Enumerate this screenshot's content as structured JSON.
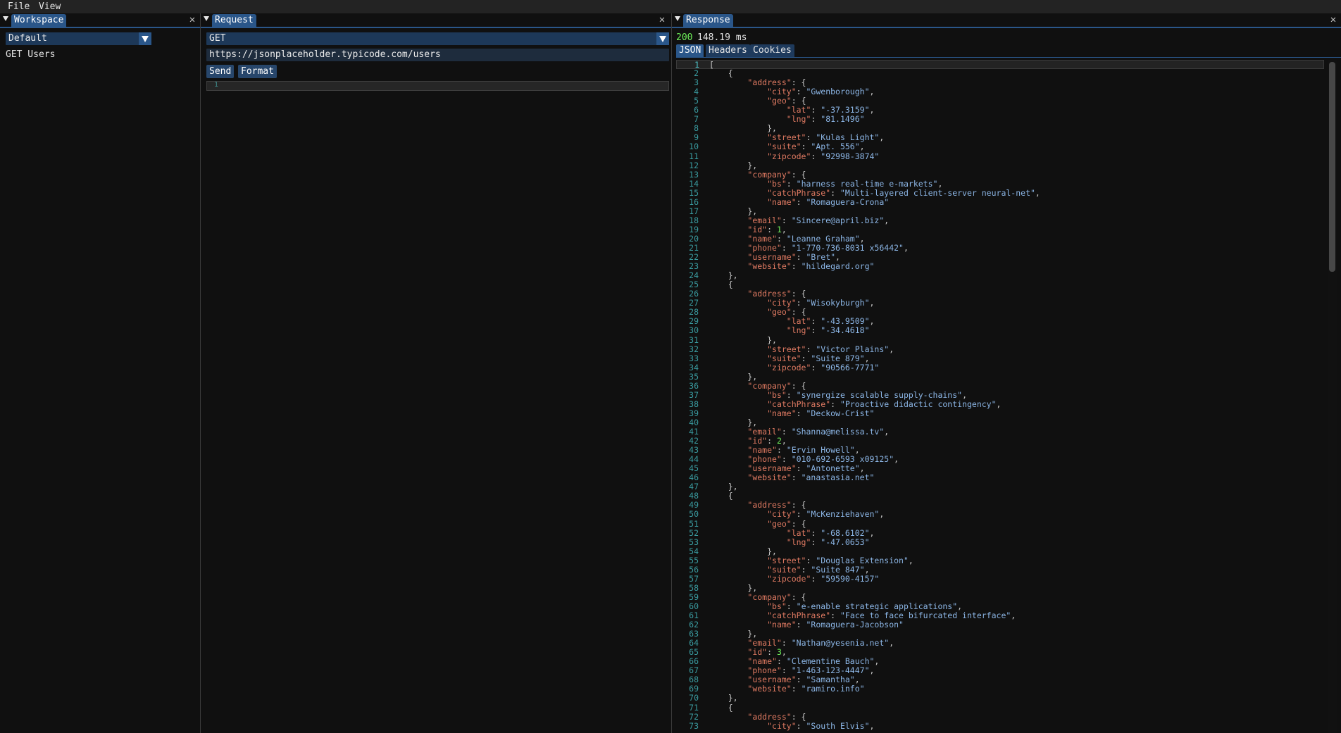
{
  "menu": {
    "file": "File",
    "view": "View"
  },
  "workspace": {
    "title": "Workspace",
    "selected": "Default",
    "items": [
      "GET Users"
    ]
  },
  "request": {
    "title": "Request",
    "method": "GET",
    "url": "https://jsonplaceholder.typicode.com/users",
    "send_label": "Send",
    "format_label": "Format",
    "body_line_number": "1"
  },
  "response": {
    "title": "Response",
    "status_code": "200",
    "time": "148.19 ms",
    "tabs": [
      "JSON",
      "Headers",
      "Cookies"
    ],
    "active_tab": "JSON"
  },
  "colors": {
    "accent": "#2a5689",
    "json_key": "#e07a62",
    "json_string": "#8cb6e6",
    "json_number": "#6ef05a",
    "line_number": "#3a9ba0",
    "status_ok": "#6ef05a"
  },
  "icons": {
    "panel_collapse": "triangle-down-icon",
    "close": "close-icon",
    "combo_arrow": "chevron-down-icon"
  },
  "json_lines": [
    [
      {
        "t": "p",
        "v": "["
      }
    ],
    [
      {
        "t": "p",
        "v": "    {"
      }
    ],
    [
      {
        "t": "p",
        "v": "        "
      },
      {
        "t": "k",
        "v": "\"address\""
      },
      {
        "t": "p",
        "v": ": {"
      }
    ],
    [
      {
        "t": "p",
        "v": "            "
      },
      {
        "t": "k",
        "v": "\"city\""
      },
      {
        "t": "p",
        "v": ": "
      },
      {
        "t": "s",
        "v": "\"Gwenborough\""
      },
      {
        "t": "p",
        "v": ","
      }
    ],
    [
      {
        "t": "p",
        "v": "            "
      },
      {
        "t": "k",
        "v": "\"geo\""
      },
      {
        "t": "p",
        "v": ": {"
      }
    ],
    [
      {
        "t": "p",
        "v": "                "
      },
      {
        "t": "k",
        "v": "\"lat\""
      },
      {
        "t": "p",
        "v": ": "
      },
      {
        "t": "s",
        "v": "\"-37.3159\""
      },
      {
        "t": "p",
        "v": ","
      }
    ],
    [
      {
        "t": "p",
        "v": "                "
      },
      {
        "t": "k",
        "v": "\"lng\""
      },
      {
        "t": "p",
        "v": ": "
      },
      {
        "t": "s",
        "v": "\"81.1496\""
      }
    ],
    [
      {
        "t": "p",
        "v": "            },"
      }
    ],
    [
      {
        "t": "p",
        "v": "            "
      },
      {
        "t": "k",
        "v": "\"street\""
      },
      {
        "t": "p",
        "v": ": "
      },
      {
        "t": "s",
        "v": "\"Kulas Light\""
      },
      {
        "t": "p",
        "v": ","
      }
    ],
    [
      {
        "t": "p",
        "v": "            "
      },
      {
        "t": "k",
        "v": "\"suite\""
      },
      {
        "t": "p",
        "v": ": "
      },
      {
        "t": "s",
        "v": "\"Apt. 556\""
      },
      {
        "t": "p",
        "v": ","
      }
    ],
    [
      {
        "t": "p",
        "v": "            "
      },
      {
        "t": "k",
        "v": "\"zipcode\""
      },
      {
        "t": "p",
        "v": ": "
      },
      {
        "t": "s",
        "v": "\"92998-3874\""
      }
    ],
    [
      {
        "t": "p",
        "v": "        },"
      }
    ],
    [
      {
        "t": "p",
        "v": "        "
      },
      {
        "t": "k",
        "v": "\"company\""
      },
      {
        "t": "p",
        "v": ": {"
      }
    ],
    [
      {
        "t": "p",
        "v": "            "
      },
      {
        "t": "k",
        "v": "\"bs\""
      },
      {
        "t": "p",
        "v": ": "
      },
      {
        "t": "s",
        "v": "\"harness real-time e-markets\""
      },
      {
        "t": "p",
        "v": ","
      }
    ],
    [
      {
        "t": "p",
        "v": "            "
      },
      {
        "t": "k",
        "v": "\"catchPhrase\""
      },
      {
        "t": "p",
        "v": ": "
      },
      {
        "t": "s",
        "v": "\"Multi-layered client-server neural-net\""
      },
      {
        "t": "p",
        "v": ","
      }
    ],
    [
      {
        "t": "p",
        "v": "            "
      },
      {
        "t": "k",
        "v": "\"name\""
      },
      {
        "t": "p",
        "v": ": "
      },
      {
        "t": "s",
        "v": "\"Romaguera-Crona\""
      }
    ],
    [
      {
        "t": "p",
        "v": "        },"
      }
    ],
    [
      {
        "t": "p",
        "v": "        "
      },
      {
        "t": "k",
        "v": "\"email\""
      },
      {
        "t": "p",
        "v": ": "
      },
      {
        "t": "s",
        "v": "\"Sincere@april.biz\""
      },
      {
        "t": "p",
        "v": ","
      }
    ],
    [
      {
        "t": "p",
        "v": "        "
      },
      {
        "t": "k",
        "v": "\"id\""
      },
      {
        "t": "p",
        "v": ": "
      },
      {
        "t": "n",
        "v": "1"
      },
      {
        "t": "p",
        "v": ","
      }
    ],
    [
      {
        "t": "p",
        "v": "        "
      },
      {
        "t": "k",
        "v": "\"name\""
      },
      {
        "t": "p",
        "v": ": "
      },
      {
        "t": "s",
        "v": "\"Leanne Graham\""
      },
      {
        "t": "p",
        "v": ","
      }
    ],
    [
      {
        "t": "p",
        "v": "        "
      },
      {
        "t": "k",
        "v": "\"phone\""
      },
      {
        "t": "p",
        "v": ": "
      },
      {
        "t": "s",
        "v": "\"1-770-736-8031 x56442\""
      },
      {
        "t": "p",
        "v": ","
      }
    ],
    [
      {
        "t": "p",
        "v": "        "
      },
      {
        "t": "k",
        "v": "\"username\""
      },
      {
        "t": "p",
        "v": ": "
      },
      {
        "t": "s",
        "v": "\"Bret\""
      },
      {
        "t": "p",
        "v": ","
      }
    ],
    [
      {
        "t": "p",
        "v": "        "
      },
      {
        "t": "k",
        "v": "\"website\""
      },
      {
        "t": "p",
        "v": ": "
      },
      {
        "t": "s",
        "v": "\"hildegard.org\""
      }
    ],
    [
      {
        "t": "p",
        "v": "    },"
      }
    ],
    [
      {
        "t": "p",
        "v": "    {"
      }
    ],
    [
      {
        "t": "p",
        "v": "        "
      },
      {
        "t": "k",
        "v": "\"address\""
      },
      {
        "t": "p",
        "v": ": {"
      }
    ],
    [
      {
        "t": "p",
        "v": "            "
      },
      {
        "t": "k",
        "v": "\"city\""
      },
      {
        "t": "p",
        "v": ": "
      },
      {
        "t": "s",
        "v": "\"Wisokyburgh\""
      },
      {
        "t": "p",
        "v": ","
      }
    ],
    [
      {
        "t": "p",
        "v": "            "
      },
      {
        "t": "k",
        "v": "\"geo\""
      },
      {
        "t": "p",
        "v": ": {"
      }
    ],
    [
      {
        "t": "p",
        "v": "                "
      },
      {
        "t": "k",
        "v": "\"lat\""
      },
      {
        "t": "p",
        "v": ": "
      },
      {
        "t": "s",
        "v": "\"-43.9509\""
      },
      {
        "t": "p",
        "v": ","
      }
    ],
    [
      {
        "t": "p",
        "v": "                "
      },
      {
        "t": "k",
        "v": "\"lng\""
      },
      {
        "t": "p",
        "v": ": "
      },
      {
        "t": "s",
        "v": "\"-34.4618\""
      }
    ],
    [
      {
        "t": "p",
        "v": "            },"
      }
    ],
    [
      {
        "t": "p",
        "v": "            "
      },
      {
        "t": "k",
        "v": "\"street\""
      },
      {
        "t": "p",
        "v": ": "
      },
      {
        "t": "s",
        "v": "\"Victor Plains\""
      },
      {
        "t": "p",
        "v": ","
      }
    ],
    [
      {
        "t": "p",
        "v": "            "
      },
      {
        "t": "k",
        "v": "\"suite\""
      },
      {
        "t": "p",
        "v": ": "
      },
      {
        "t": "s",
        "v": "\"Suite 879\""
      },
      {
        "t": "p",
        "v": ","
      }
    ],
    [
      {
        "t": "p",
        "v": "            "
      },
      {
        "t": "k",
        "v": "\"zipcode\""
      },
      {
        "t": "p",
        "v": ": "
      },
      {
        "t": "s",
        "v": "\"90566-7771\""
      }
    ],
    [
      {
        "t": "p",
        "v": "        },"
      }
    ],
    [
      {
        "t": "p",
        "v": "        "
      },
      {
        "t": "k",
        "v": "\"company\""
      },
      {
        "t": "p",
        "v": ": {"
      }
    ],
    [
      {
        "t": "p",
        "v": "            "
      },
      {
        "t": "k",
        "v": "\"bs\""
      },
      {
        "t": "p",
        "v": ": "
      },
      {
        "t": "s",
        "v": "\"synergize scalable supply-chains\""
      },
      {
        "t": "p",
        "v": ","
      }
    ],
    [
      {
        "t": "p",
        "v": "            "
      },
      {
        "t": "k",
        "v": "\"catchPhrase\""
      },
      {
        "t": "p",
        "v": ": "
      },
      {
        "t": "s",
        "v": "\"Proactive didactic contingency\""
      },
      {
        "t": "p",
        "v": ","
      }
    ],
    [
      {
        "t": "p",
        "v": "            "
      },
      {
        "t": "k",
        "v": "\"name\""
      },
      {
        "t": "p",
        "v": ": "
      },
      {
        "t": "s",
        "v": "\"Deckow-Crist\""
      }
    ],
    [
      {
        "t": "p",
        "v": "        },"
      }
    ],
    [
      {
        "t": "p",
        "v": "        "
      },
      {
        "t": "k",
        "v": "\"email\""
      },
      {
        "t": "p",
        "v": ": "
      },
      {
        "t": "s",
        "v": "\"Shanna@melissa.tv\""
      },
      {
        "t": "p",
        "v": ","
      }
    ],
    [
      {
        "t": "p",
        "v": "        "
      },
      {
        "t": "k",
        "v": "\"id\""
      },
      {
        "t": "p",
        "v": ": "
      },
      {
        "t": "n",
        "v": "2"
      },
      {
        "t": "p",
        "v": ","
      }
    ],
    [
      {
        "t": "p",
        "v": "        "
      },
      {
        "t": "k",
        "v": "\"name\""
      },
      {
        "t": "p",
        "v": ": "
      },
      {
        "t": "s",
        "v": "\"Ervin Howell\""
      },
      {
        "t": "p",
        "v": ","
      }
    ],
    [
      {
        "t": "p",
        "v": "        "
      },
      {
        "t": "k",
        "v": "\"phone\""
      },
      {
        "t": "p",
        "v": ": "
      },
      {
        "t": "s",
        "v": "\"010-692-6593 x09125\""
      },
      {
        "t": "p",
        "v": ","
      }
    ],
    [
      {
        "t": "p",
        "v": "        "
      },
      {
        "t": "k",
        "v": "\"username\""
      },
      {
        "t": "p",
        "v": ": "
      },
      {
        "t": "s",
        "v": "\"Antonette\""
      },
      {
        "t": "p",
        "v": ","
      }
    ],
    [
      {
        "t": "p",
        "v": "        "
      },
      {
        "t": "k",
        "v": "\"website\""
      },
      {
        "t": "p",
        "v": ": "
      },
      {
        "t": "s",
        "v": "\"anastasia.net\""
      }
    ],
    [
      {
        "t": "p",
        "v": "    },"
      }
    ],
    [
      {
        "t": "p",
        "v": "    {"
      }
    ],
    [
      {
        "t": "p",
        "v": "        "
      },
      {
        "t": "k",
        "v": "\"address\""
      },
      {
        "t": "p",
        "v": ": {"
      }
    ],
    [
      {
        "t": "p",
        "v": "            "
      },
      {
        "t": "k",
        "v": "\"city\""
      },
      {
        "t": "p",
        "v": ": "
      },
      {
        "t": "s",
        "v": "\"McKenziehaven\""
      },
      {
        "t": "p",
        "v": ","
      }
    ],
    [
      {
        "t": "p",
        "v": "            "
      },
      {
        "t": "k",
        "v": "\"geo\""
      },
      {
        "t": "p",
        "v": ": {"
      }
    ],
    [
      {
        "t": "p",
        "v": "                "
      },
      {
        "t": "k",
        "v": "\"lat\""
      },
      {
        "t": "p",
        "v": ": "
      },
      {
        "t": "s",
        "v": "\"-68.6102\""
      },
      {
        "t": "p",
        "v": ","
      }
    ],
    [
      {
        "t": "p",
        "v": "                "
      },
      {
        "t": "k",
        "v": "\"lng\""
      },
      {
        "t": "p",
        "v": ": "
      },
      {
        "t": "s",
        "v": "\"-47.0653\""
      }
    ],
    [
      {
        "t": "p",
        "v": "            },"
      }
    ],
    [
      {
        "t": "p",
        "v": "            "
      },
      {
        "t": "k",
        "v": "\"street\""
      },
      {
        "t": "p",
        "v": ": "
      },
      {
        "t": "s",
        "v": "\"Douglas Extension\""
      },
      {
        "t": "p",
        "v": ","
      }
    ],
    [
      {
        "t": "p",
        "v": "            "
      },
      {
        "t": "k",
        "v": "\"suite\""
      },
      {
        "t": "p",
        "v": ": "
      },
      {
        "t": "s",
        "v": "\"Suite 847\""
      },
      {
        "t": "p",
        "v": ","
      }
    ],
    [
      {
        "t": "p",
        "v": "            "
      },
      {
        "t": "k",
        "v": "\"zipcode\""
      },
      {
        "t": "p",
        "v": ": "
      },
      {
        "t": "s",
        "v": "\"59590-4157\""
      }
    ],
    [
      {
        "t": "p",
        "v": "        },"
      }
    ],
    [
      {
        "t": "p",
        "v": "        "
      },
      {
        "t": "k",
        "v": "\"company\""
      },
      {
        "t": "p",
        "v": ": {"
      }
    ],
    [
      {
        "t": "p",
        "v": "            "
      },
      {
        "t": "k",
        "v": "\"bs\""
      },
      {
        "t": "p",
        "v": ": "
      },
      {
        "t": "s",
        "v": "\"e-enable strategic applications\""
      },
      {
        "t": "p",
        "v": ","
      }
    ],
    [
      {
        "t": "p",
        "v": "            "
      },
      {
        "t": "k",
        "v": "\"catchPhrase\""
      },
      {
        "t": "p",
        "v": ": "
      },
      {
        "t": "s",
        "v": "\"Face to face bifurcated interface\""
      },
      {
        "t": "p",
        "v": ","
      }
    ],
    [
      {
        "t": "p",
        "v": "            "
      },
      {
        "t": "k",
        "v": "\"name\""
      },
      {
        "t": "p",
        "v": ": "
      },
      {
        "t": "s",
        "v": "\"Romaguera-Jacobson\""
      }
    ],
    [
      {
        "t": "p",
        "v": "        },"
      }
    ],
    [
      {
        "t": "p",
        "v": "        "
      },
      {
        "t": "k",
        "v": "\"email\""
      },
      {
        "t": "p",
        "v": ": "
      },
      {
        "t": "s",
        "v": "\"Nathan@yesenia.net\""
      },
      {
        "t": "p",
        "v": ","
      }
    ],
    [
      {
        "t": "p",
        "v": "        "
      },
      {
        "t": "k",
        "v": "\"id\""
      },
      {
        "t": "p",
        "v": ": "
      },
      {
        "t": "n",
        "v": "3"
      },
      {
        "t": "p",
        "v": ","
      }
    ],
    [
      {
        "t": "p",
        "v": "        "
      },
      {
        "t": "k",
        "v": "\"name\""
      },
      {
        "t": "p",
        "v": ": "
      },
      {
        "t": "s",
        "v": "\"Clementine Bauch\""
      },
      {
        "t": "p",
        "v": ","
      }
    ],
    [
      {
        "t": "p",
        "v": "        "
      },
      {
        "t": "k",
        "v": "\"phone\""
      },
      {
        "t": "p",
        "v": ": "
      },
      {
        "t": "s",
        "v": "\"1-463-123-4447\""
      },
      {
        "t": "p",
        "v": ","
      }
    ],
    [
      {
        "t": "p",
        "v": "        "
      },
      {
        "t": "k",
        "v": "\"username\""
      },
      {
        "t": "p",
        "v": ": "
      },
      {
        "t": "s",
        "v": "\"Samantha\""
      },
      {
        "t": "p",
        "v": ","
      }
    ],
    [
      {
        "t": "p",
        "v": "        "
      },
      {
        "t": "k",
        "v": "\"website\""
      },
      {
        "t": "p",
        "v": ": "
      },
      {
        "t": "s",
        "v": "\"ramiro.info\""
      }
    ],
    [
      {
        "t": "p",
        "v": "    },"
      }
    ],
    [
      {
        "t": "p",
        "v": "    {"
      }
    ],
    [
      {
        "t": "p",
        "v": "        "
      },
      {
        "t": "k",
        "v": "\"address\""
      },
      {
        "t": "p",
        "v": ": {"
      }
    ],
    [
      {
        "t": "p",
        "v": "            "
      },
      {
        "t": "k",
        "v": "\"city\""
      },
      {
        "t": "p",
        "v": ": "
      },
      {
        "t": "s",
        "v": "\"South Elvis\""
      },
      {
        "t": "p",
        "v": ","
      }
    ]
  ]
}
